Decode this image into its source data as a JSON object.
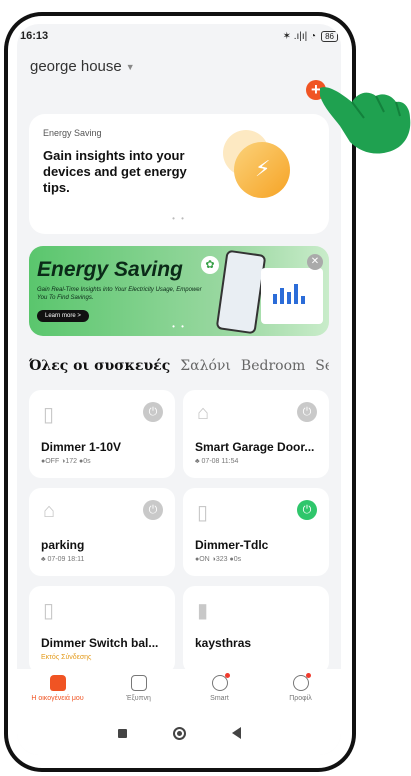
{
  "status_bar": {
    "time": "16:13",
    "signal": "✶ .ı|ı| ◔",
    "battery": "86"
  },
  "header": {
    "home_name": "george house"
  },
  "energy_card": {
    "label": "Energy Saving",
    "headline": "Gain insights into your devices and get energy tips.",
    "dots": "• •"
  },
  "banner": {
    "title": "Energy Saving",
    "subtitle": "Gain Real-Time Insights into Your Electricity Usage, Empower You To Find Savings.",
    "learn_more": "Learn more >",
    "dots": "• •"
  },
  "tabs": [
    {
      "label": "Όλες οι συσκευές"
    },
    {
      "label": "Σαλόνι"
    },
    {
      "label": "Bedroom"
    },
    {
      "label": "Se"
    }
  ],
  "devices": [
    {
      "name": "Dimmer 1-10V",
      "status": "●OFF  ◑172  ●0s"
    },
    {
      "name": "Smart Garage Door...",
      "status": "♣ 07-08 11:54"
    },
    {
      "name": "parking",
      "status": "♣ 07-09 18:11"
    },
    {
      "name": "Dimmer-Tdlc",
      "status": "●ON  ◑323  ●0s"
    },
    {
      "name": "Dimmer Switch bal...",
      "status": "Εκτός Σύνδεσης"
    },
    {
      "name": "kaysthras",
      "status": ""
    }
  ],
  "nav": [
    {
      "label": "Η οικογένειά μου"
    },
    {
      "label": "Έξυπνη"
    },
    {
      "label": "Smart"
    },
    {
      "label": "Προφίλ"
    }
  ],
  "colors": {
    "accent": "#f05423",
    "power_on": "#2fc66b",
    "offline": "#e39a1a"
  }
}
